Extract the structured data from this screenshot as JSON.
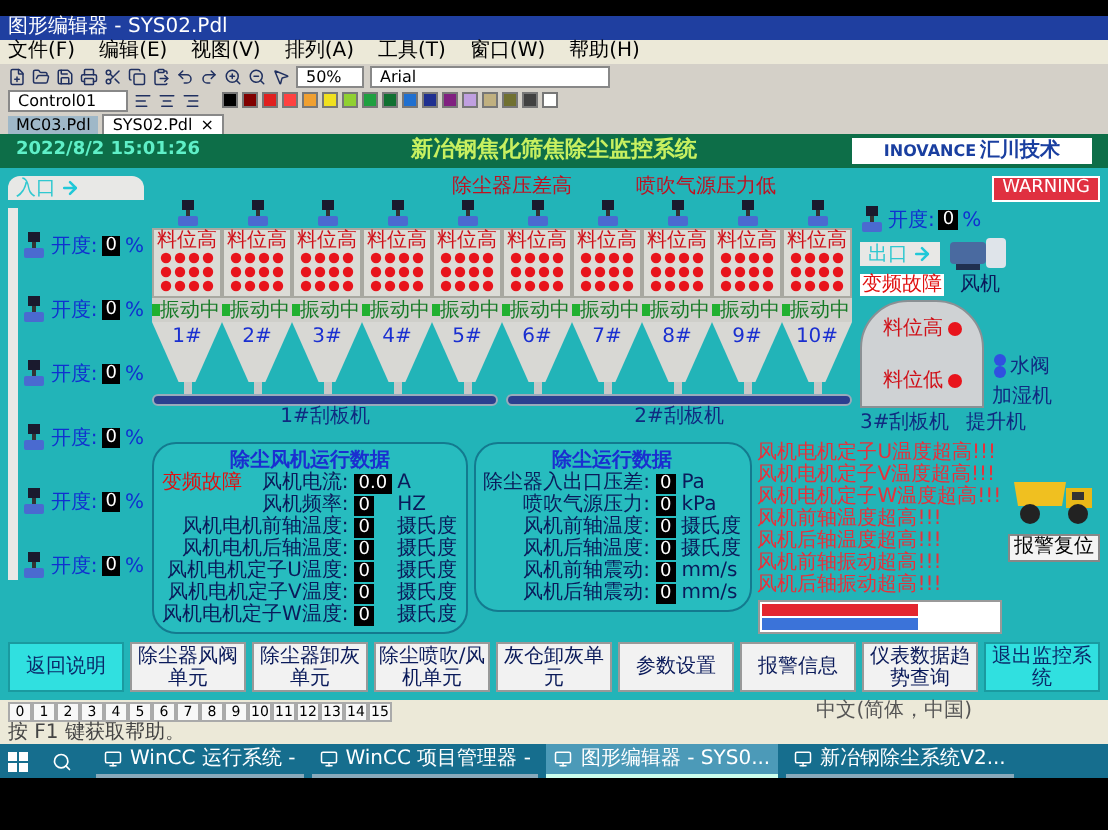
{
  "window": {
    "title": "图形编辑器 - SYS02.Pdl"
  },
  "menu": [
    "文件(F)",
    "编辑(E)",
    "视图(V)",
    "排列(A)",
    "工具(T)",
    "窗口(W)",
    "帮助(H)"
  ],
  "toolbar": {
    "zoom": "50%",
    "font": "Arial",
    "object": "Control01",
    "palette": [
      {
        "color": "#000000"
      },
      {
        "color": "#800000"
      },
      {
        "color": "#e02020"
      },
      {
        "color": "#ff4040"
      },
      {
        "color": "#f0a030"
      },
      {
        "color": "#f0e020"
      },
      {
        "color": "#90d030"
      },
      {
        "color": "#20a040"
      },
      {
        "color": "#107030"
      },
      {
        "color": "#2070d0"
      },
      {
        "color": "#203090"
      },
      {
        "color": "#802080"
      },
      {
        "color": "#c0a0e0"
      },
      {
        "color": "#c0b080"
      },
      {
        "color": "#707030"
      },
      {
        "color": "#404040"
      },
      {
        "color": "#ffffff"
      }
    ]
  },
  "tabs": [
    {
      "label": "MC03.Pdl",
      "selected": false
    },
    {
      "label": "SYS02.Pdl",
      "selected": true,
      "close": "×"
    }
  ],
  "header": {
    "datetime": "2022/8/2 15:01:26",
    "title": "新冶钢焦化筛焦除尘监控系统",
    "logo": "INOVANCE",
    "logo_cn": "汇川技术"
  },
  "alarm_labels": [
    "除尘器压差高",
    "喷吹气源压力低"
  ],
  "warning": "WARNING",
  "inlet": "入口",
  "inlet_valves": [
    {
      "label": "开度:",
      "value": "0",
      "unit": "%"
    },
    {
      "label": "开度:",
      "value": "0",
      "unit": "%"
    },
    {
      "label": "开度:",
      "value": "0",
      "unit": "%"
    },
    {
      "label": "开度:",
      "value": "0",
      "unit": "%"
    },
    {
      "label": "开度:",
      "value": "0",
      "unit": "%"
    },
    {
      "label": "开度:",
      "value": "0",
      "unit": "%"
    }
  ],
  "filters": [
    {
      "level_label": "料位高",
      "status": "振动中",
      "vibrating": true,
      "name": "1#"
    },
    {
      "level_label": "料位高",
      "status": "振动中",
      "vibrating": true,
      "name": "2#"
    },
    {
      "level_label": "料位高",
      "status": "振动中",
      "vibrating": true,
      "name": "3#"
    },
    {
      "level_label": "料位高",
      "status": "振动中",
      "vibrating": true,
      "name": "4#"
    },
    {
      "level_label": "料位高",
      "status": "振动中",
      "vibrating": true,
      "name": "5#"
    },
    {
      "level_label": "料位高",
      "status": "振动中",
      "vibrating": true,
      "name": "6#"
    },
    {
      "level_label": "料位高",
      "status": "振动中",
      "vibrating": true,
      "name": "7#"
    },
    {
      "level_label": "料位高",
      "status": "振动中",
      "vibrating": true,
      "name": "8#"
    },
    {
      "level_label": "料位高",
      "status": "振动中",
      "vibrating": true,
      "name": "9#"
    },
    {
      "level_label": "料位高",
      "status": "振动中",
      "vibrating": true,
      "name": "10#"
    }
  ],
  "conveyors": [
    "1#刮板机",
    "2#刮板机"
  ],
  "fan": {
    "valve": {
      "label": "开度:",
      "value": "0",
      "unit": "%"
    },
    "outlet": "出口",
    "fault": "变频故障",
    "name": "风机"
  },
  "silo": {
    "high": "料位高",
    "low": "料位低"
  },
  "equipment": {
    "water_valve": "水阀",
    "humidifier": "加湿机",
    "conveyor": "3#刮板机",
    "elevator": "提升机"
  },
  "fan_panel": {
    "title": "除尘风机运行数据",
    "fault": "变频故障",
    "rows": [
      {
        "label": "风机电流:",
        "value": "0.0",
        "unit": "A"
      },
      {
        "label": "风机频率:",
        "value": "0",
        "unit": "HZ"
      },
      {
        "label": "风机电机前轴温度:",
        "value": "0",
        "unit": "摄氏度"
      },
      {
        "label": "风机电机后轴温度:",
        "value": "0",
        "unit": "摄氏度"
      },
      {
        "label": "风机电机定子U温度:",
        "value": "0",
        "unit": "摄氏度"
      },
      {
        "label": "风机电机定子V温度:",
        "value": "0",
        "unit": "摄氏度"
      },
      {
        "label": "风机电机定子W温度:",
        "value": "0",
        "unit": "摄氏度"
      }
    ]
  },
  "dust_panel": {
    "title": "除尘运行数据",
    "rows": [
      {
        "label": "除尘器入出口压差:",
        "value": "0",
        "unit": "Pa"
      },
      {
        "label": "喷吹气源压力:",
        "value": "0",
        "unit": "kPa"
      },
      {
        "label": "风机前轴温度:",
        "value": "0",
        "unit": "摄氏度"
      },
      {
        "label": "风机后轴温度:",
        "value": "0",
        "unit": "摄氏度"
      },
      {
        "label": "风机前轴震动:",
        "value": "0",
        "unit": "mm/s"
      },
      {
        "label": "风机后轴震动:",
        "value": "0",
        "unit": "mm/s"
      }
    ]
  },
  "alarms": [
    "风机电机定子U温度超高!!!",
    "风机电机定子V温度超高!!!",
    "风机电机定子W温度超高!!!",
    "风机前轴温度超高!!!",
    "风机后轴温度超高!!!",
    "风机前轴振动超高!!!",
    "风机后轴振动超高!!!"
  ],
  "alarm_table": {
    "rows": [
      {
        "color": "#e3262f"
      },
      {
        "color": "#3b73d9"
      }
    ]
  },
  "reset_button": "报警复位",
  "nav_buttons": [
    {
      "label": "返回说明",
      "selected": true
    },
    {
      "label": "除尘器风阀单元",
      "selected": false
    },
    {
      "label": "除尘器卸灰单元",
      "selected": false
    },
    {
      "label": "除尘喷吹/风机单元",
      "selected": false
    },
    {
      "label": "灰仓卸灰单元",
      "selected": false
    },
    {
      "label": "参数设置",
      "selected": false
    },
    {
      "label": "报警信息",
      "selected": false
    },
    {
      "label": "仪表数据趋势查询",
      "selected": false
    },
    {
      "label": "退出监控系统",
      "selected": true
    }
  ],
  "status_bar": {
    "layers": [
      "0",
      "1",
      "2",
      "3",
      "4",
      "5",
      "6",
      "7",
      "8",
      "9",
      "10",
      "11",
      "12",
      "13",
      "14",
      "15"
    ],
    "locale": "中文(简体，中国)",
    "hint": "按 F1 键获取帮助。"
  },
  "taskbar": {
    "items": [
      {
        "label": "WinCC 运行系统 -",
        "active": false
      },
      {
        "label": "WinCC 项目管理器 -",
        "active": false
      },
      {
        "label": "图形编辑器 - SYS0...",
        "active": true
      },
      {
        "label": "新冶钢除尘系统V2...",
        "active": false
      }
    ]
  }
}
